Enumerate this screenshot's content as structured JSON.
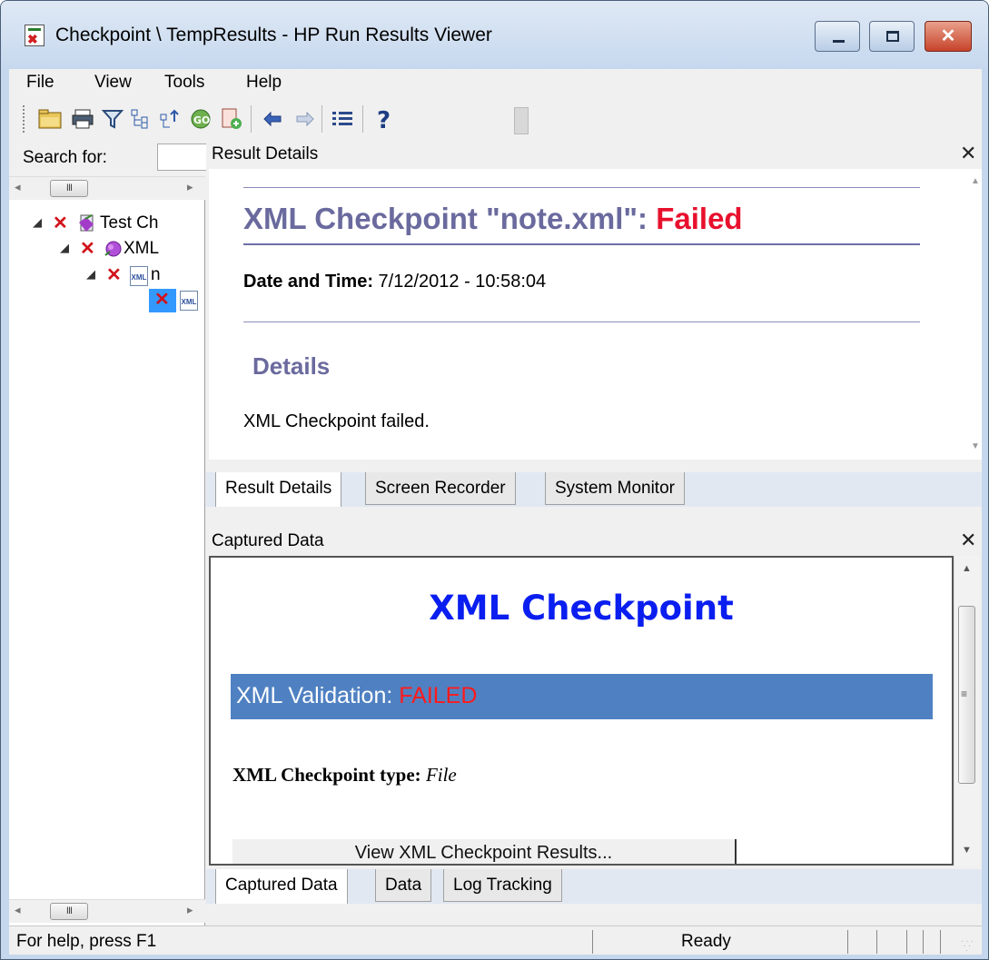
{
  "window": {
    "title": "Checkpoint \\ TempResults - HP Run Results Viewer"
  },
  "menu": {
    "items": [
      "File",
      "View",
      "Tools",
      "Help"
    ]
  },
  "toolbar": {
    "icons": [
      "open-folder-icon",
      "print-icon",
      "filter-icon",
      "expand-all-icon",
      "collapse-all-icon",
      "go-to-node-icon",
      "export-icon",
      "back-arrow-icon",
      "forward-arrow-icon",
      "list-icon",
      "help-icon"
    ]
  },
  "left_pane": {
    "search_label": "Search for:",
    "tree": [
      {
        "label": "Test Ch",
        "status": "failed"
      },
      {
        "label": "XML",
        "status": "failed"
      },
      {
        "label": "n",
        "status": "failed"
      },
      {
        "label": "",
        "status": "failed"
      }
    ]
  },
  "result_details": {
    "panel_title": "Result Details",
    "heading_prefix": "XML Checkpoint \"note.xml\": ",
    "heading_status": "Failed",
    "date_label": "Date and Time:",
    "date_value": " 7/12/2012 - 10:58:04",
    "details_heading": "Details",
    "message": "XML Checkpoint failed.",
    "tabs": [
      "Result Details",
      "Screen Recorder",
      "System Monitor"
    ]
  },
  "captured_data": {
    "panel_title": "Captured Data",
    "heading": "XML Checkpoint",
    "validation_label": "XML Validation: ",
    "validation_status": "FAILED",
    "type_label": "XML Checkpoint type:",
    "type_value": " File",
    "button_label": "View XML Checkpoint Results...",
    "tabs": [
      "Captured Data",
      "Data",
      "Log Tracking"
    ]
  },
  "status_bar": {
    "help_text": "For help, press F1",
    "state": "Ready"
  },
  "colors": {
    "failed_red": "#e8112d",
    "heading_purple": "#6a6a9e",
    "capture_blue": "#0a1ef0",
    "band_blue": "#4f81c2"
  }
}
